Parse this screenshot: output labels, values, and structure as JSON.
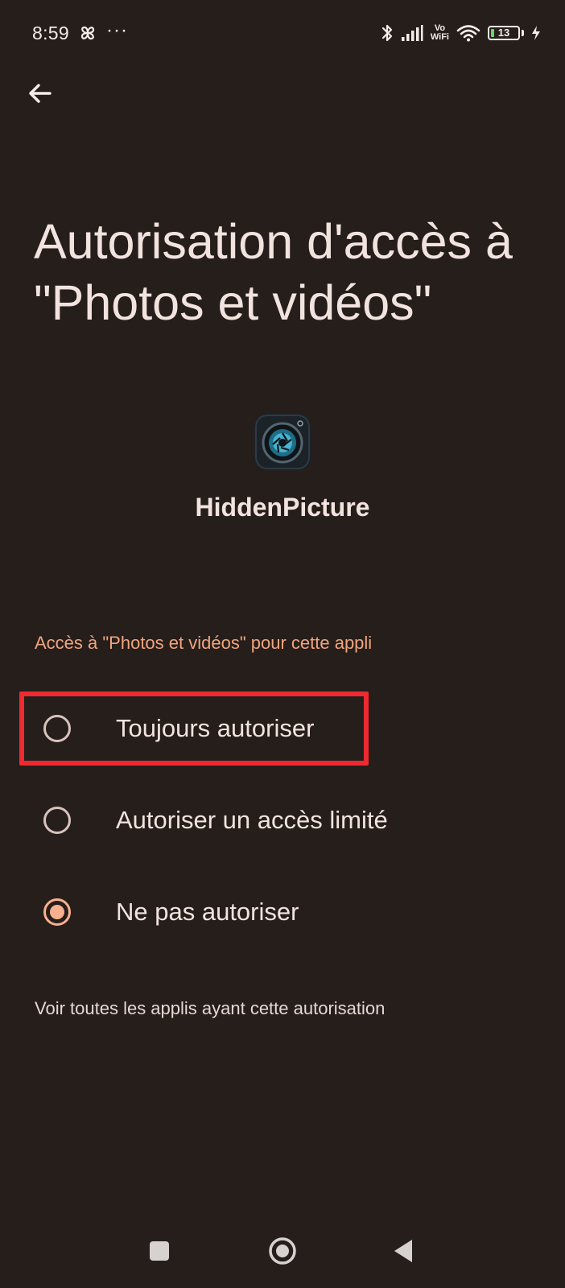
{
  "status_bar": {
    "time": "8:59",
    "overflow": "···",
    "vowifi_top": "Vo",
    "vowifi_bottom": "WiFi",
    "battery_level": "13",
    "icons": [
      "pinwheel-icon",
      "bluetooth-icon",
      "signal-icon",
      "vowifi-icon",
      "wifi-icon",
      "battery-icon",
      "charging-icon"
    ]
  },
  "header": {
    "back_icon": "arrow-left-icon",
    "title": "Autorisation d'accès à \"Photos et vidéos\""
  },
  "app": {
    "icon": "camera-aperture-icon",
    "name": "HiddenPicture"
  },
  "permission": {
    "section_header": "Accès à \"Photos et vidéos\" pour cette appli",
    "options": [
      {
        "label": "Toujours autoriser",
        "selected": false
      },
      {
        "label": "Autoriser un accès limité",
        "selected": false
      },
      {
        "label": "Ne pas autoriser",
        "selected": true
      }
    ],
    "highlighted_option_index": 0,
    "highlight_color": "#ee2a30",
    "accent_color": "#f8b08f",
    "see_all_link": "Voir toutes les applis ayant cette autorisation"
  },
  "nav_bar": {
    "buttons": [
      "recents-square-icon",
      "home-circle-icon",
      "back-triangle-icon"
    ]
  },
  "colors": {
    "background": "#261e1b",
    "text": "#f2e3de",
    "section_header": "#f0a57f"
  }
}
